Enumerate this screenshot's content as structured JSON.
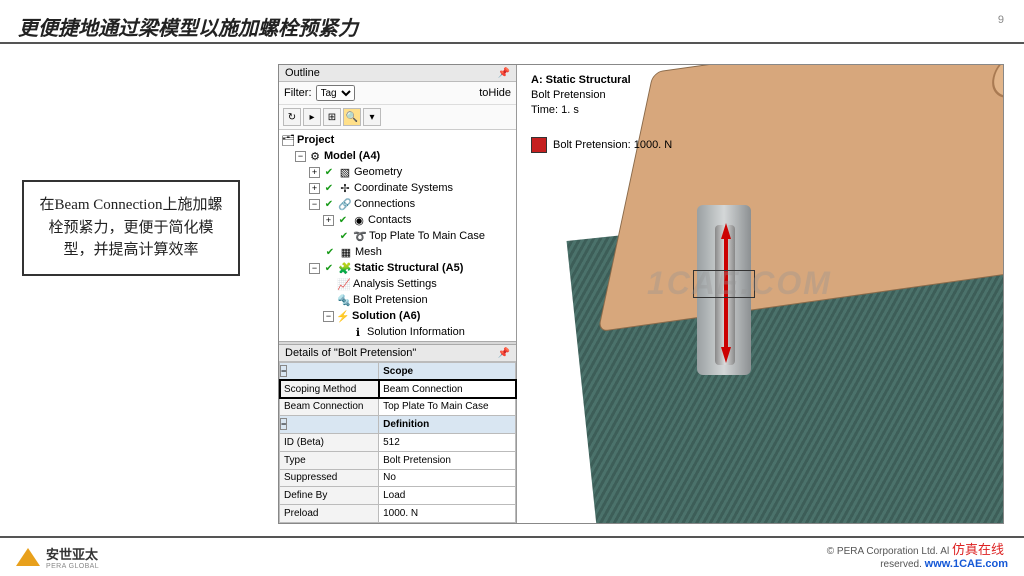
{
  "slide": {
    "title": "更便捷地通过梁模型以施加螺栓预紧力",
    "page": "9"
  },
  "annotation": "在Beam Connection上施加螺栓预紧力，更便于简化模型，并提高计算效率",
  "outline": {
    "header": "Outline",
    "filter_label": "Filter:",
    "filter_value": "Tag",
    "filter_text": "toHide",
    "tree": {
      "root": "Project",
      "model": "Model (A4)",
      "geometry": "Geometry",
      "coord": "Coordinate Systems",
      "connections": "Connections",
      "contacts": "Contacts",
      "topplate": "Top Plate To Main Case",
      "mesh": "Mesh",
      "static": "Static Structural (A5)",
      "analysis": "Analysis Settings",
      "boltp": "Bolt Pretension",
      "solution": "Solution (A6)",
      "solinfo": "Solution Information"
    }
  },
  "details": {
    "header": "Details of \"Bolt Pretension\"",
    "groups": {
      "scope": "Scope",
      "scoping_method_l": "Scoping Method",
      "scoping_method_v": "Beam Connection",
      "beam_conn_l": "Beam Connection",
      "beam_conn_v": "Top Plate To Main Case",
      "definition": "Definition",
      "id_l": "ID (Beta)",
      "id_v": "512",
      "type_l": "Type",
      "type_v": "Bolt Pretension",
      "supp_l": "Suppressed",
      "supp_v": "No",
      "def_l": "Define By",
      "def_v": "Load",
      "pre_l": "Preload",
      "pre_v": "1000. N"
    }
  },
  "viewport": {
    "title": "A: Static Structural",
    "sub1": "Bolt Pretension",
    "sub2": "Time: 1. s",
    "legend": "Bolt Pretension: 1000. N",
    "watermark": "1CAE.COM"
  },
  "footer": {
    "logo": "安世亚太",
    "logo_sub": "PERA GLOBAL",
    "copy1": "© PERA Corporation Ltd. Al",
    "copy2": "reserved.",
    "site_cn": "仿真在线",
    "site": "www.1CAE.com"
  }
}
